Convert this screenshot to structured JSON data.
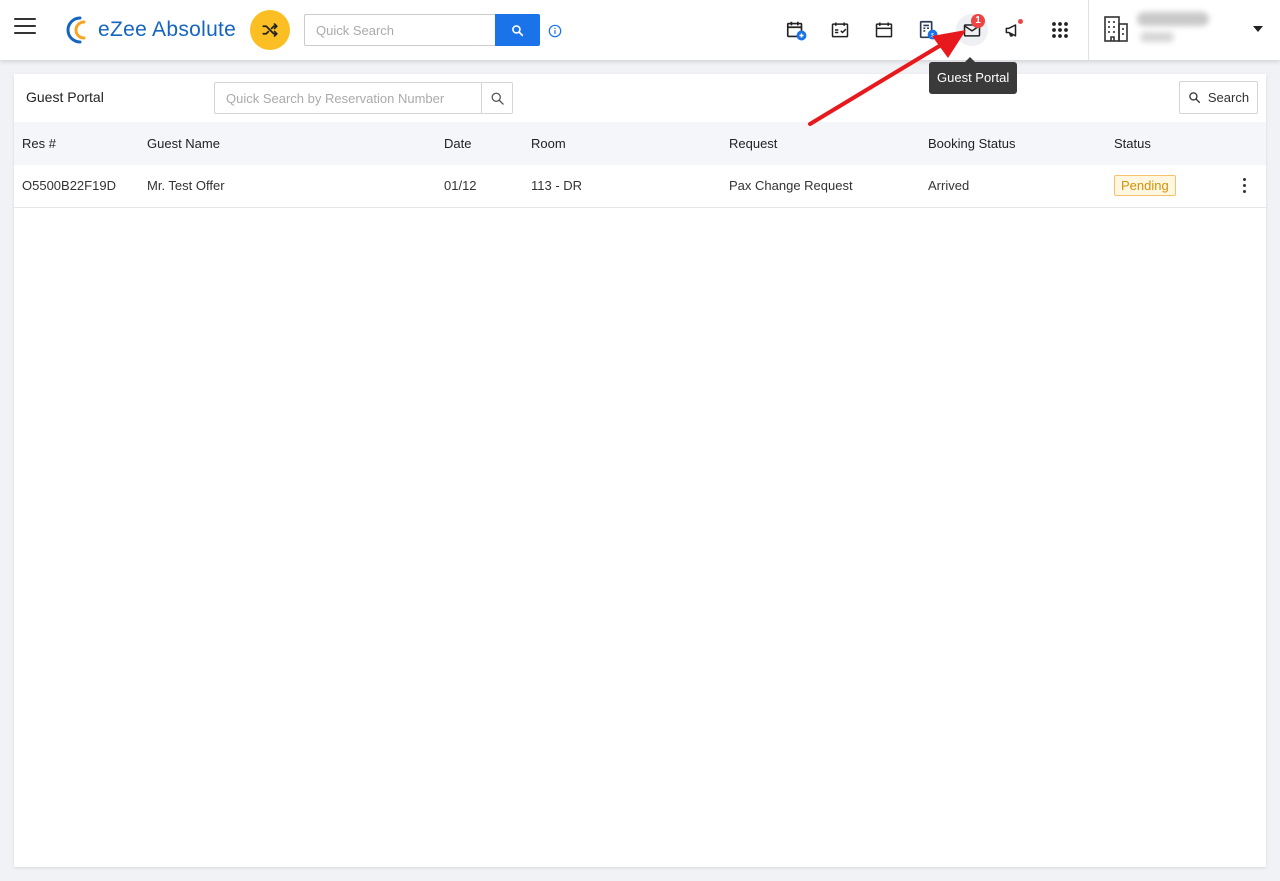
{
  "header": {
    "brand": "eZee Absolute",
    "quick_search_placeholder": "Quick Search",
    "icons": [
      "hamburger-icon",
      "shuffle-icon",
      "search-icon",
      "info-icon",
      "add-reservation-icon",
      "checkin-icon",
      "calendar-icon",
      "billing-icon",
      "mail-icon",
      "announcement-icon",
      "apps-grid-icon",
      "hotel-building-icon",
      "caret-down-icon"
    ],
    "mail_badge": "1",
    "tooltip": "Guest Portal"
  },
  "panel": {
    "title": "Guest Portal",
    "search_placeholder": "Quick Search by Reservation Number",
    "search_button": "Search"
  },
  "table": {
    "columns": [
      "Res #",
      "Guest Name",
      "Date",
      "Room",
      "Request",
      "Booking Status",
      "Status"
    ],
    "rows": [
      {
        "res": "O5500B22F19D",
        "guest_name": "Mr. Test Offer",
        "date": "01/12",
        "room": "113 - DR",
        "request": "Pax Change Request",
        "booking_status": "Arrived",
        "status": "Pending"
      }
    ]
  },
  "colors": {
    "primary": "#1a73e8",
    "accent_yellow": "#fbbf24",
    "badge_red": "#ef4444",
    "pending_text": "#d4910a",
    "arrow_red": "#e8191c"
  }
}
